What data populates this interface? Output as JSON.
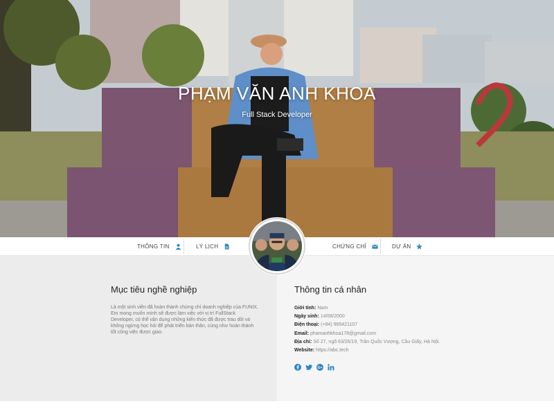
{
  "hero": {
    "name": "PHẠM VĂN ANH KHOA",
    "role": "Full Stack Developer"
  },
  "nav": {
    "items": [
      {
        "label": "THÔNG TIN",
        "icon": "user-icon"
      },
      {
        "label": "LÝ LỊCH",
        "icon": "document-icon"
      },
      {
        "label": "CHỨNG CHỈ",
        "icon": "envelope-icon"
      },
      {
        "label": "DỰ ÁN",
        "icon": "star-icon"
      }
    ]
  },
  "objective": {
    "title": "Mục tiêu nghề nghiệp",
    "text": "Là một sinh viên đã hoàn thành chứng chỉ doanh nghiệp của FUNIX. Em mong muốn mình sẽ được làm việc với vị trí FullStack Developer, có thể vận dụng những kiến thức đã được trau dồi và không ngừng học hỏi để phát triển bản thân, cùng như hoàn thành tốt công việc được giao."
  },
  "personal": {
    "title": "Thông tin cá nhân",
    "rows": [
      {
        "label": "Giới tính:",
        "value": "Nam"
      },
      {
        "label": "Ngày sinh:",
        "value": "14/08/2000"
      },
      {
        "label": "Điện thoại:",
        "value": "(+84) 965421107"
      },
      {
        "label": "Email:",
        "value": "phamanhkhoa178@gmail.com"
      },
      {
        "label": "Địa chỉ:",
        "value": "Số 27, ngõ 63/26/19, Trần Quốc Vượng, Cầu Giấy, Hà Nội."
      },
      {
        "label": "Website:",
        "value": "https://abc.tech"
      }
    ]
  },
  "socials": [
    "facebook-icon",
    "twitter-icon",
    "google-plus-icon",
    "linkedin-icon"
  ],
  "colors": {
    "accent": "#2a86c6",
    "content_bg_left": "#ececec",
    "content_bg_right": "#f5f5f5"
  }
}
